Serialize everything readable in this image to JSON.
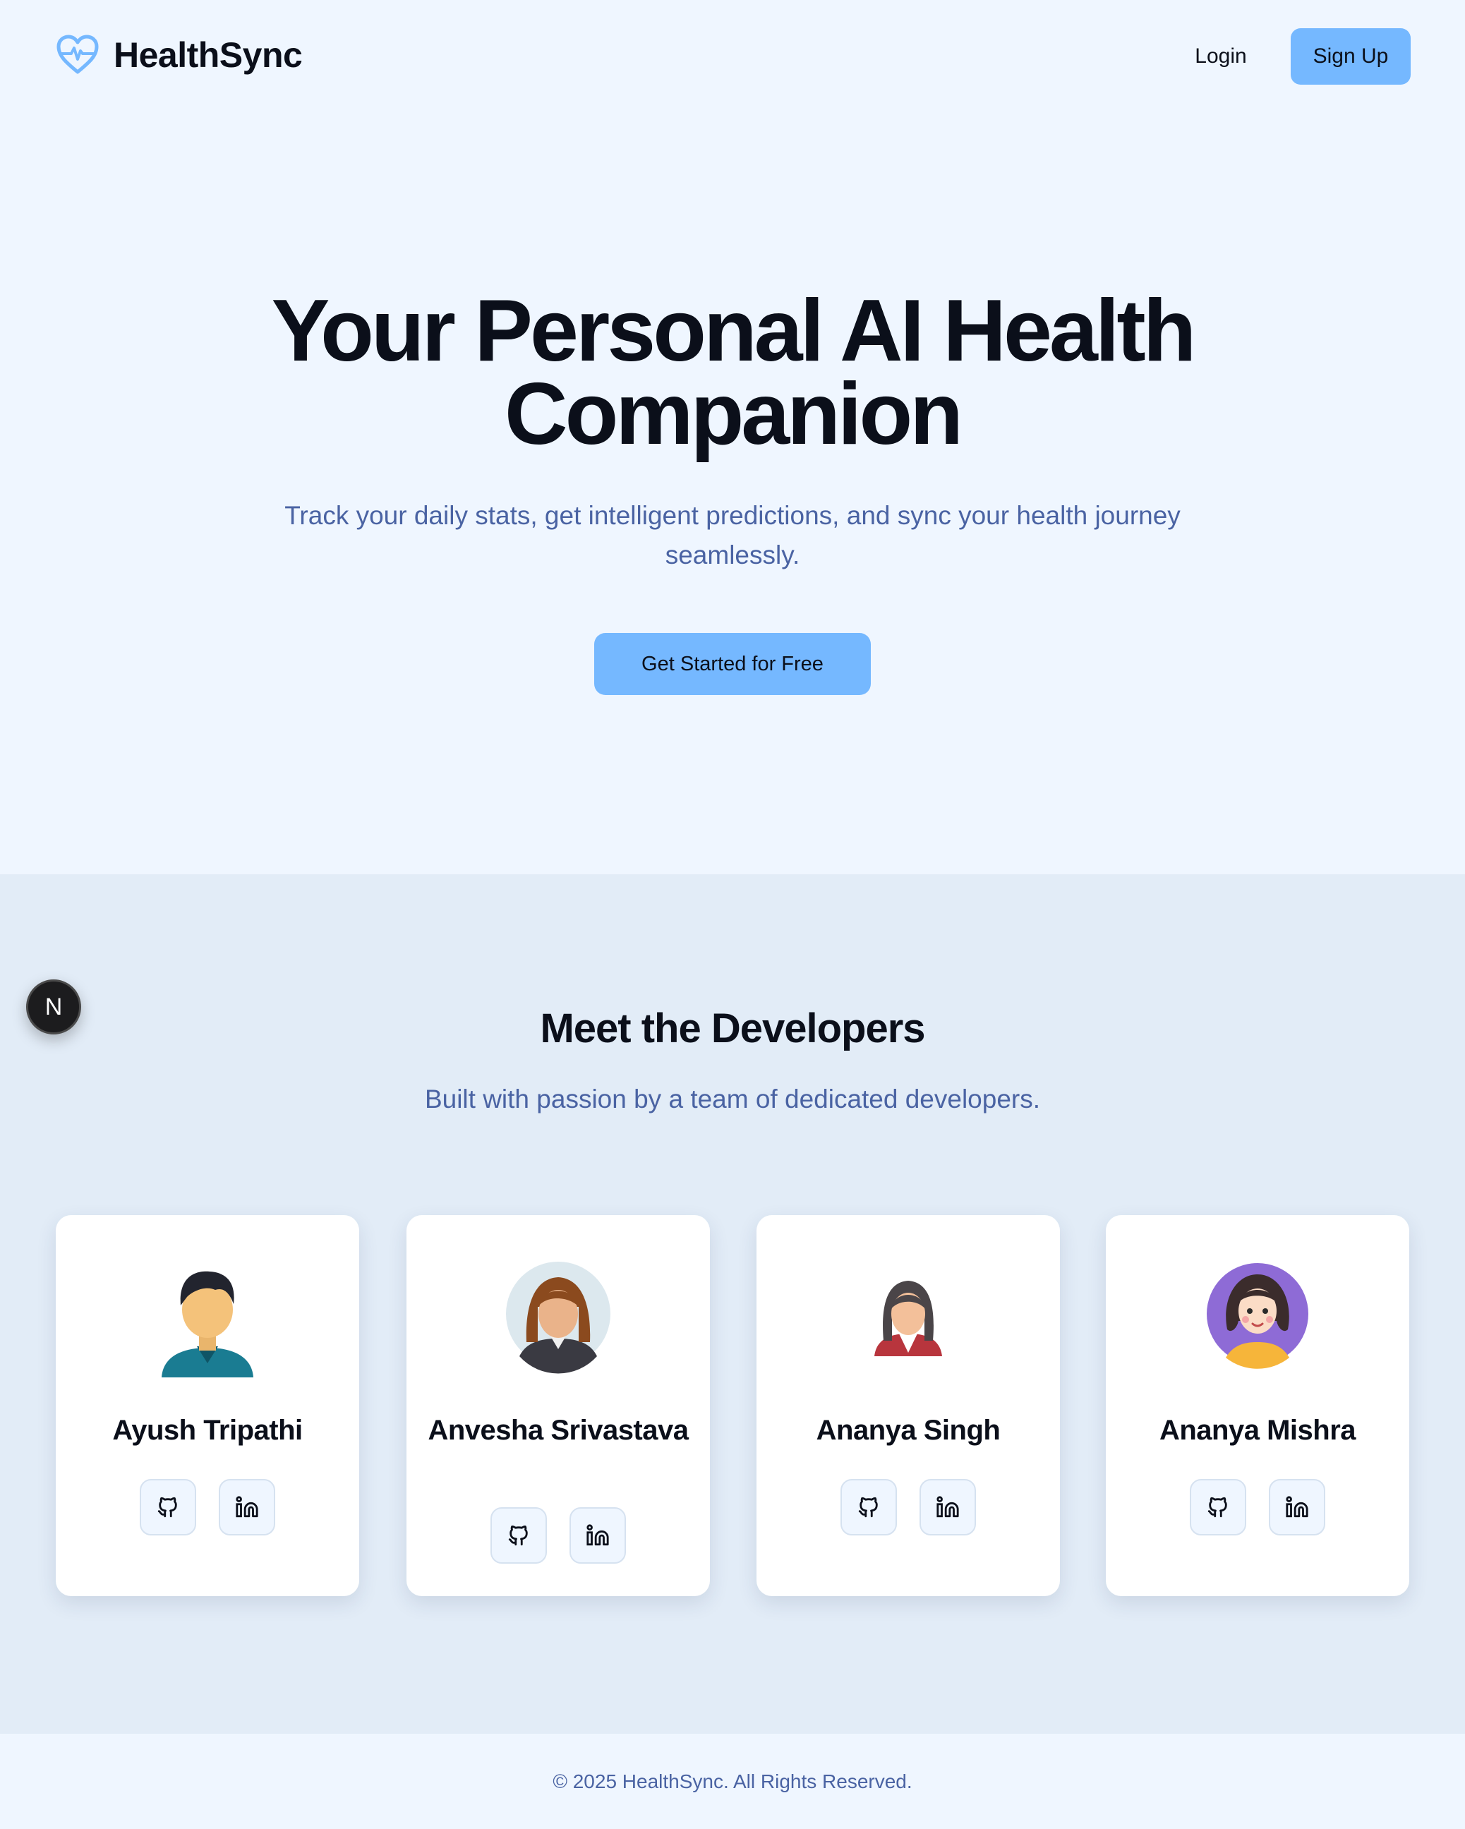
{
  "app": {
    "name": "HealthSync",
    "brand_color": "#75b8ff"
  },
  "nav": {
    "logo_icon": "heart-pulse-icon",
    "login_label": "Login",
    "signup_label": "Sign Up"
  },
  "hero": {
    "title_line1": "Your Personal AI Health",
    "title_line2": "Companion",
    "subtitle": "Track your daily stats, get intelligent predictions, and sync your health journey seamlessly.",
    "cta_label": "Get Started for Free"
  },
  "developers": {
    "title": "Meet the Developers",
    "subtitle": "Built with passion by a team of dedicated developers.",
    "floating_badge": "N",
    "members": [
      {
        "name": "Ayush Tripathi",
        "avatar": "male-avatar-icon",
        "links": [
          "github-icon",
          "linkedin-icon"
        ]
      },
      {
        "name": "Anvesha Srivastava",
        "avatar": "female-avatar-icon",
        "links": [
          "github-icon",
          "linkedin-icon"
        ]
      },
      {
        "name": "Ananya Singh",
        "avatar": "female-avatar-icon",
        "links": [
          "github-icon",
          "linkedin-icon"
        ]
      },
      {
        "name": "Ananya Mishra",
        "avatar": "female-avatar-icon",
        "links": [
          "github-icon",
          "linkedin-icon"
        ]
      }
    ]
  },
  "footer": {
    "copyright": "© 2025 HealthSync. All Rights Reserved."
  }
}
